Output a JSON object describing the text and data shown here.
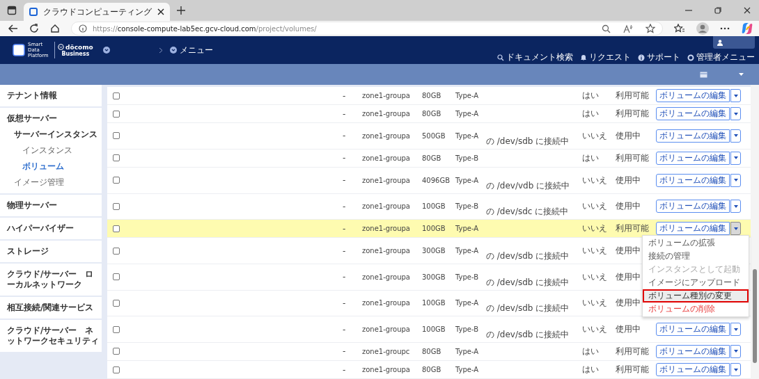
{
  "browser": {
    "tab_title": "クラウドコンピューティング",
    "url": [
      {
        "text": "https://",
        "dim": true
      },
      {
        "text": "console-compute-lab5ec.gcv-cloud.com",
        "dim": false
      },
      {
        "text": "/project/volumes/",
        "dim": true
      }
    ]
  },
  "header": {
    "logo_text": "Smart Data Platform",
    "brand_name": "döcomo",
    "brand_sub": "Business",
    "breadcrumb": "メニュー",
    "links": [
      {
        "label": "ドキュメント検索"
      },
      {
        "label": "リクエスト"
      },
      {
        "label": "サポート"
      },
      {
        "label": "管理者メニュー"
      }
    ]
  },
  "sidebar": {
    "items": [
      {
        "label": "テナント情報",
        "selected": false
      },
      {
        "label": "仮想サーバー",
        "selected": false,
        "children": [
          {
            "label": "サーバーインスタンス",
            "selected": false,
            "children": [
              {
                "label": "インスタンス",
                "selected": false
              },
              {
                "label": "ボリューム",
                "selected": true
              }
            ]
          },
          {
            "label": "イメージ管理",
            "selected": false
          }
        ]
      },
      {
        "label": "物理サーバー",
        "selected": false
      },
      {
        "label": "ハイパーバイザー",
        "selected": false
      },
      {
        "label": "ストレージ",
        "selected": false
      },
      {
        "label": "クラウド/サーバー　ローカルネットワーク",
        "selected": false
      },
      {
        "label": "相互接続/関連サービス",
        "selected": false
      },
      {
        "label": "クラウド/サーバー　ネットワークセキュリティ",
        "selected": false
      }
    ]
  },
  "table": {
    "rows": [
      {
        "selected": false,
        "checked": false,
        "dash": "-",
        "zone": "zone1-groupa",
        "size": "80GB",
        "type": "Type-A",
        "bootable": "はい",
        "status": "利用可能",
        "action": "ボリュームの編集",
        "menu_open": false
      },
      {
        "selected": false,
        "checked": false,
        "dash": "-",
        "zone": "zone1-groupa",
        "size": "80GB",
        "type": "Type-A",
        "bootable": "はい",
        "status": "利用可能",
        "action": "ボリュームの編集",
        "menu_open": false
      },
      {
        "selected": false,
        "checked": false,
        "dash": "-",
        "zone": "zone1-groupa",
        "size": "500GB",
        "type": "Type-A",
        "attachment": "の /dev/sdb に接続中",
        "bootable": "いいえ",
        "status": "使用中",
        "action": "ボリュームの編集",
        "menu_open": false
      },
      {
        "selected": false,
        "checked": false,
        "dash": "-",
        "zone": "zone1-groupa",
        "size": "80GB",
        "type": "Type-B",
        "bootable": "はい",
        "status": "利用可能",
        "action": "ボリュームの編集",
        "menu_open": false
      },
      {
        "selected": false,
        "checked": false,
        "dash": "-",
        "zone": "zone1-groupa",
        "size": "4096GB",
        "type": "Type-A",
        "attachment": "の /dev/vdb に接続中",
        "bootable": "いいえ",
        "status": "使用中",
        "action": "ボリュームの編集",
        "menu_open": false
      },
      {
        "selected": false,
        "checked": false,
        "dash": "-",
        "zone": "zone1-groupa",
        "size": "100GB",
        "type": "Type-B",
        "attachment": "の /dev/sdc に接続中",
        "bootable": "いいえ",
        "status": "使用中",
        "action": "ボリュームの編集",
        "menu_open": false
      },
      {
        "selected": true,
        "checked": false,
        "dash": "-",
        "zone": "zone1-groupa",
        "size": "100GB",
        "type": "Type-A",
        "bootable": "いいえ",
        "status": "利用可能",
        "action": "ボリュームの編集",
        "menu_open": true
      },
      {
        "selected": false,
        "checked": false,
        "dash": "-",
        "zone": "zone1-groupa",
        "size": "300GB",
        "type": "Type-A",
        "attachment": "の /dev/sdb に接続中",
        "bootable": "いいえ",
        "status": "使用中",
        "menu_open": false
      },
      {
        "selected": false,
        "checked": false,
        "dash": "-",
        "zone": "zone1-groupa",
        "size": "300GB",
        "type": "Type-B",
        "attachment": "の /dev/sdb に接続中",
        "bootable": "いいえ",
        "status": "使用中",
        "menu_open": false
      },
      {
        "selected": false,
        "checked": false,
        "dash": "-",
        "zone": "zone1-groupa",
        "size": "100GB",
        "type": "Type-A",
        "attachment": "の /dev/sdb に接続中",
        "bootable": "いいえ",
        "status": "使用中",
        "menu_open": false
      },
      {
        "selected": false,
        "checked": false,
        "dash": "-",
        "zone": "zone1-groupa",
        "size": "100GB",
        "type": "Type-B",
        "attachment": "の /dev/sdb に接続中",
        "bootable": "いいえ",
        "status": "使用中",
        "action": "ボリュームの編集",
        "menu_open": false
      },
      {
        "selected": false,
        "checked": false,
        "dash": "-",
        "zone": "zone1-groupc",
        "size": "80GB",
        "type": "Type-A",
        "bootable": "はい",
        "status": "利用可能",
        "action": "ボリュームの編集",
        "menu_open": false
      },
      {
        "selected": false,
        "checked": false,
        "dash": "-",
        "zone": "zone1-groupa",
        "size": "80GB",
        "type": "Type-A",
        "bootable": "はい",
        "status": "利用可能",
        "action": "ボリュームの編集",
        "menu_open": false
      }
    ]
  },
  "action_menu": {
    "items": [
      {
        "label": "ボリュームの拡張",
        "kind": "normal",
        "highlighted": false
      },
      {
        "label": "接続の管理",
        "kind": "normal",
        "highlighted": false
      },
      {
        "label": "インスタンスとして起動",
        "kind": "disabled",
        "highlighted": false
      },
      {
        "label": "イメージにアップロード",
        "kind": "normal",
        "highlighted": false
      },
      {
        "label": "ボリューム種別の変更",
        "kind": "normal",
        "highlighted": true
      },
      {
        "label": "ボリュームの削除",
        "kind": "danger",
        "highlighted": false
      }
    ]
  }
}
